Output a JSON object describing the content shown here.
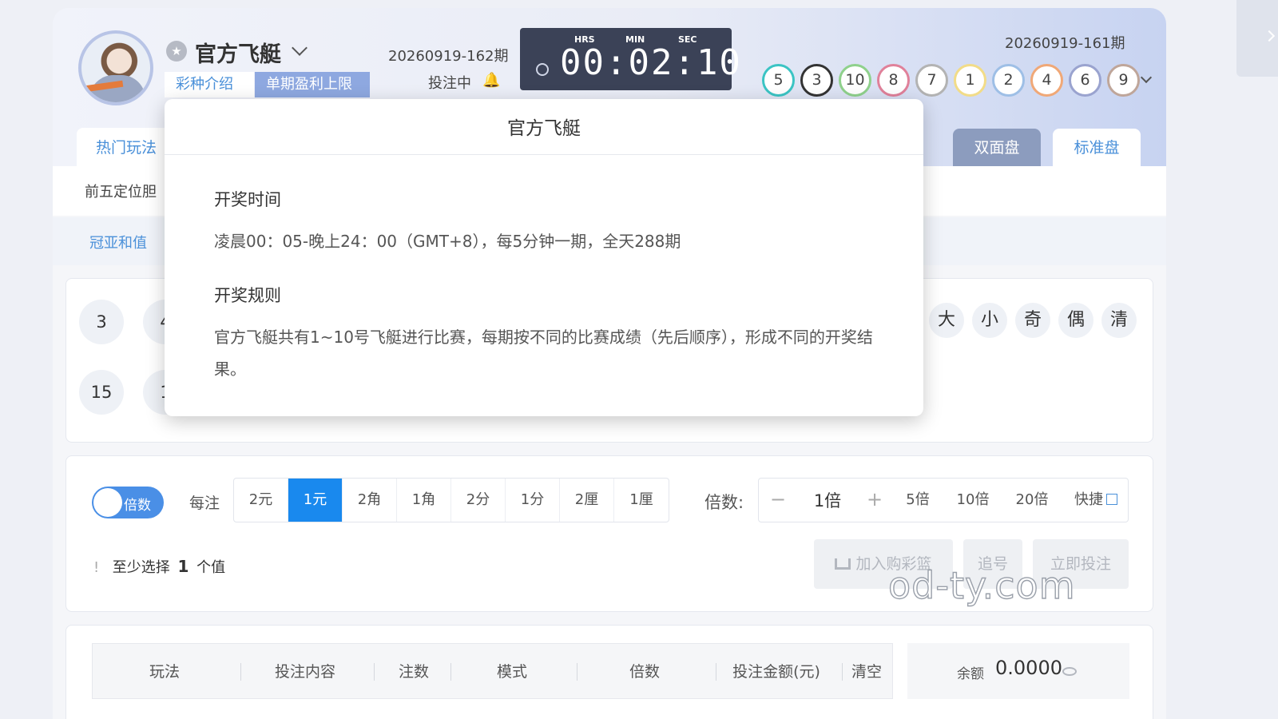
{
  "header": {
    "lottery_name": "官方飞艇",
    "tags": [
      "彩种介绍",
      "单期盈利上限"
    ],
    "current_period": "20260919-162期",
    "status": "投注中",
    "countdown": {
      "labels": [
        "HRS",
        "MIN",
        "SEC"
      ],
      "time": "00:02:10"
    },
    "last_period": "20260919-161期",
    "last_result": [
      "5",
      "3",
      "10",
      "8",
      "7",
      "1",
      "2",
      "4",
      "6",
      "9"
    ],
    "ball_colors": [
      "#3bc4c4",
      "#333333",
      "#8fd18c",
      "#e0819a",
      "#b3b3b3",
      "#f2dc88",
      "#9ebfe6",
      "#f0a877",
      "#9aa3cf",
      "#bfa69a"
    ]
  },
  "tabs": {
    "left": "热门玩法",
    "shuang": "双面盘",
    "biao": "标准盘"
  },
  "sub_tabs": {
    "row1": "前五定位胆",
    "row2": "冠亚和值"
  },
  "numbers": {
    "row1_first": "3",
    "row1_second_partial": "4",
    "row2_first": "15",
    "row2_second_partial": "1"
  },
  "quick_picks": [
    "大",
    "小",
    "奇",
    "偶",
    "清"
  ],
  "bet": {
    "toggle_label": "倍数",
    "unit_label": "每注",
    "units": [
      "2元",
      "1元",
      "2角",
      "1角",
      "2分",
      "1分",
      "2厘",
      "1厘"
    ],
    "active_unit": "1元",
    "multiplier_label": "倍数:",
    "multiplier_minus": "−",
    "multiplier_value": "1倍",
    "multiplier_plus": "+",
    "multiplier_options": [
      "5倍",
      "10倍",
      "20倍"
    ],
    "shortcut_label": "快捷",
    "hint_icon": "!",
    "hint_pre": "至少选择",
    "hint_count": "1",
    "hint_post": "个值",
    "add_cart": "加入购彩篮",
    "chase": "追号",
    "bet_now": "立即投注"
  },
  "table": {
    "headers": [
      "玩法",
      "投注内容",
      "注数",
      "模式",
      "倍数",
      "投注金额(元)",
      "清空"
    ],
    "balance_label": "余额",
    "balance_value": "0.0000"
  },
  "modal": {
    "title": "官方飞艇",
    "section1_title": "开奖时间",
    "section1_text": "凌晨00：05-晚上24：00（GMT+8），每5分钟一期，全天288期",
    "section2_title": "开奖规则",
    "section2_text": "官方飞艇共有1~10号飞艇进行比赛，每期按不同的比赛成绩（先后顺序），形成不同的开奖结果。"
  },
  "watermark": "od-ty.com"
}
